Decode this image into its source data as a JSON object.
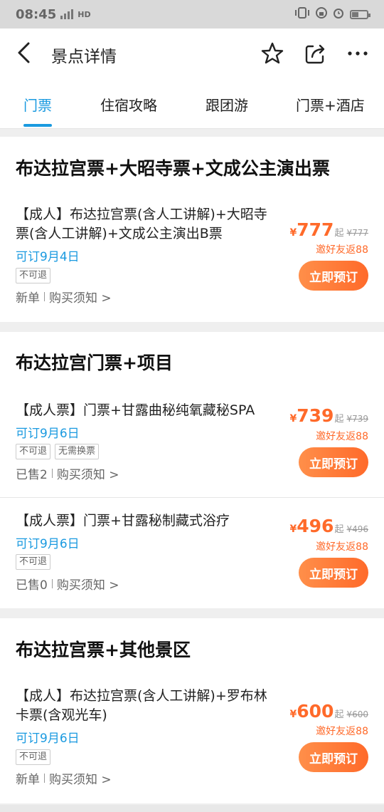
{
  "status_bar": {
    "time": "08:45",
    "network": "HD"
  },
  "nav": {
    "title": "景点详情"
  },
  "tabs": [
    {
      "label": "门票",
      "active": true
    },
    {
      "label": "住宿攻略",
      "active": false
    },
    {
      "label": "跟团游",
      "active": false
    },
    {
      "label": "门票+酒店",
      "active": false
    }
  ],
  "sections": [
    {
      "title": "布达拉宫票+大昭寺票+文成公主演出票",
      "items": [
        {
          "name": "【成人】布达拉宫票(含人工讲解)+大昭寺票(含人工讲解)+文成公主演出B票",
          "availability": "可订9月4日",
          "tags": [
            "不可退"
          ],
          "sold": "新单",
          "notice": "购买须知 >",
          "currency": "¥",
          "price": "777",
          "price_suffix": "起",
          "original_price": "¥777",
          "rebate": "邀好友返88",
          "button": "立即预订"
        }
      ]
    },
    {
      "title": "布达拉宫门票+项目",
      "items": [
        {
          "name": "【成人票】门票+甘露曲秘纯氧藏秘SPA",
          "availability": "可订9月6日",
          "tags": [
            "不可退",
            "无需换票"
          ],
          "sold": "已售2",
          "notice": "购买须知 >",
          "currency": "¥",
          "price": "739",
          "price_suffix": "起",
          "original_price": "¥739",
          "rebate": "邀好友返88",
          "button": "立即预订"
        },
        {
          "name": "【成人票】门票+甘露秘制藏式浴疗",
          "availability": "可订9月6日",
          "tags": [
            "不可退"
          ],
          "sold": "已售0",
          "notice": "购买须知 >",
          "currency": "¥",
          "price": "496",
          "price_suffix": "起",
          "original_price": "¥496",
          "rebate": "邀好友返88",
          "button": "立即预订"
        }
      ]
    },
    {
      "title": "布达拉宫票+其他景区",
      "items": [
        {
          "name": "【成人】布达拉宫票(含人工讲解)+罗布林卡票(含观光车)",
          "availability": "可订9月6日",
          "tags": [
            "不可退"
          ],
          "sold": "新单",
          "notice": "购买须知 >",
          "currency": "¥",
          "price": "600",
          "price_suffix": "起",
          "original_price": "¥600",
          "rebate": "邀好友返88",
          "button": "立即预订"
        }
      ]
    }
  ],
  "colors": {
    "accent": "#1a9ae0",
    "price": "#ff6a2a",
    "background": "#efefef"
  }
}
